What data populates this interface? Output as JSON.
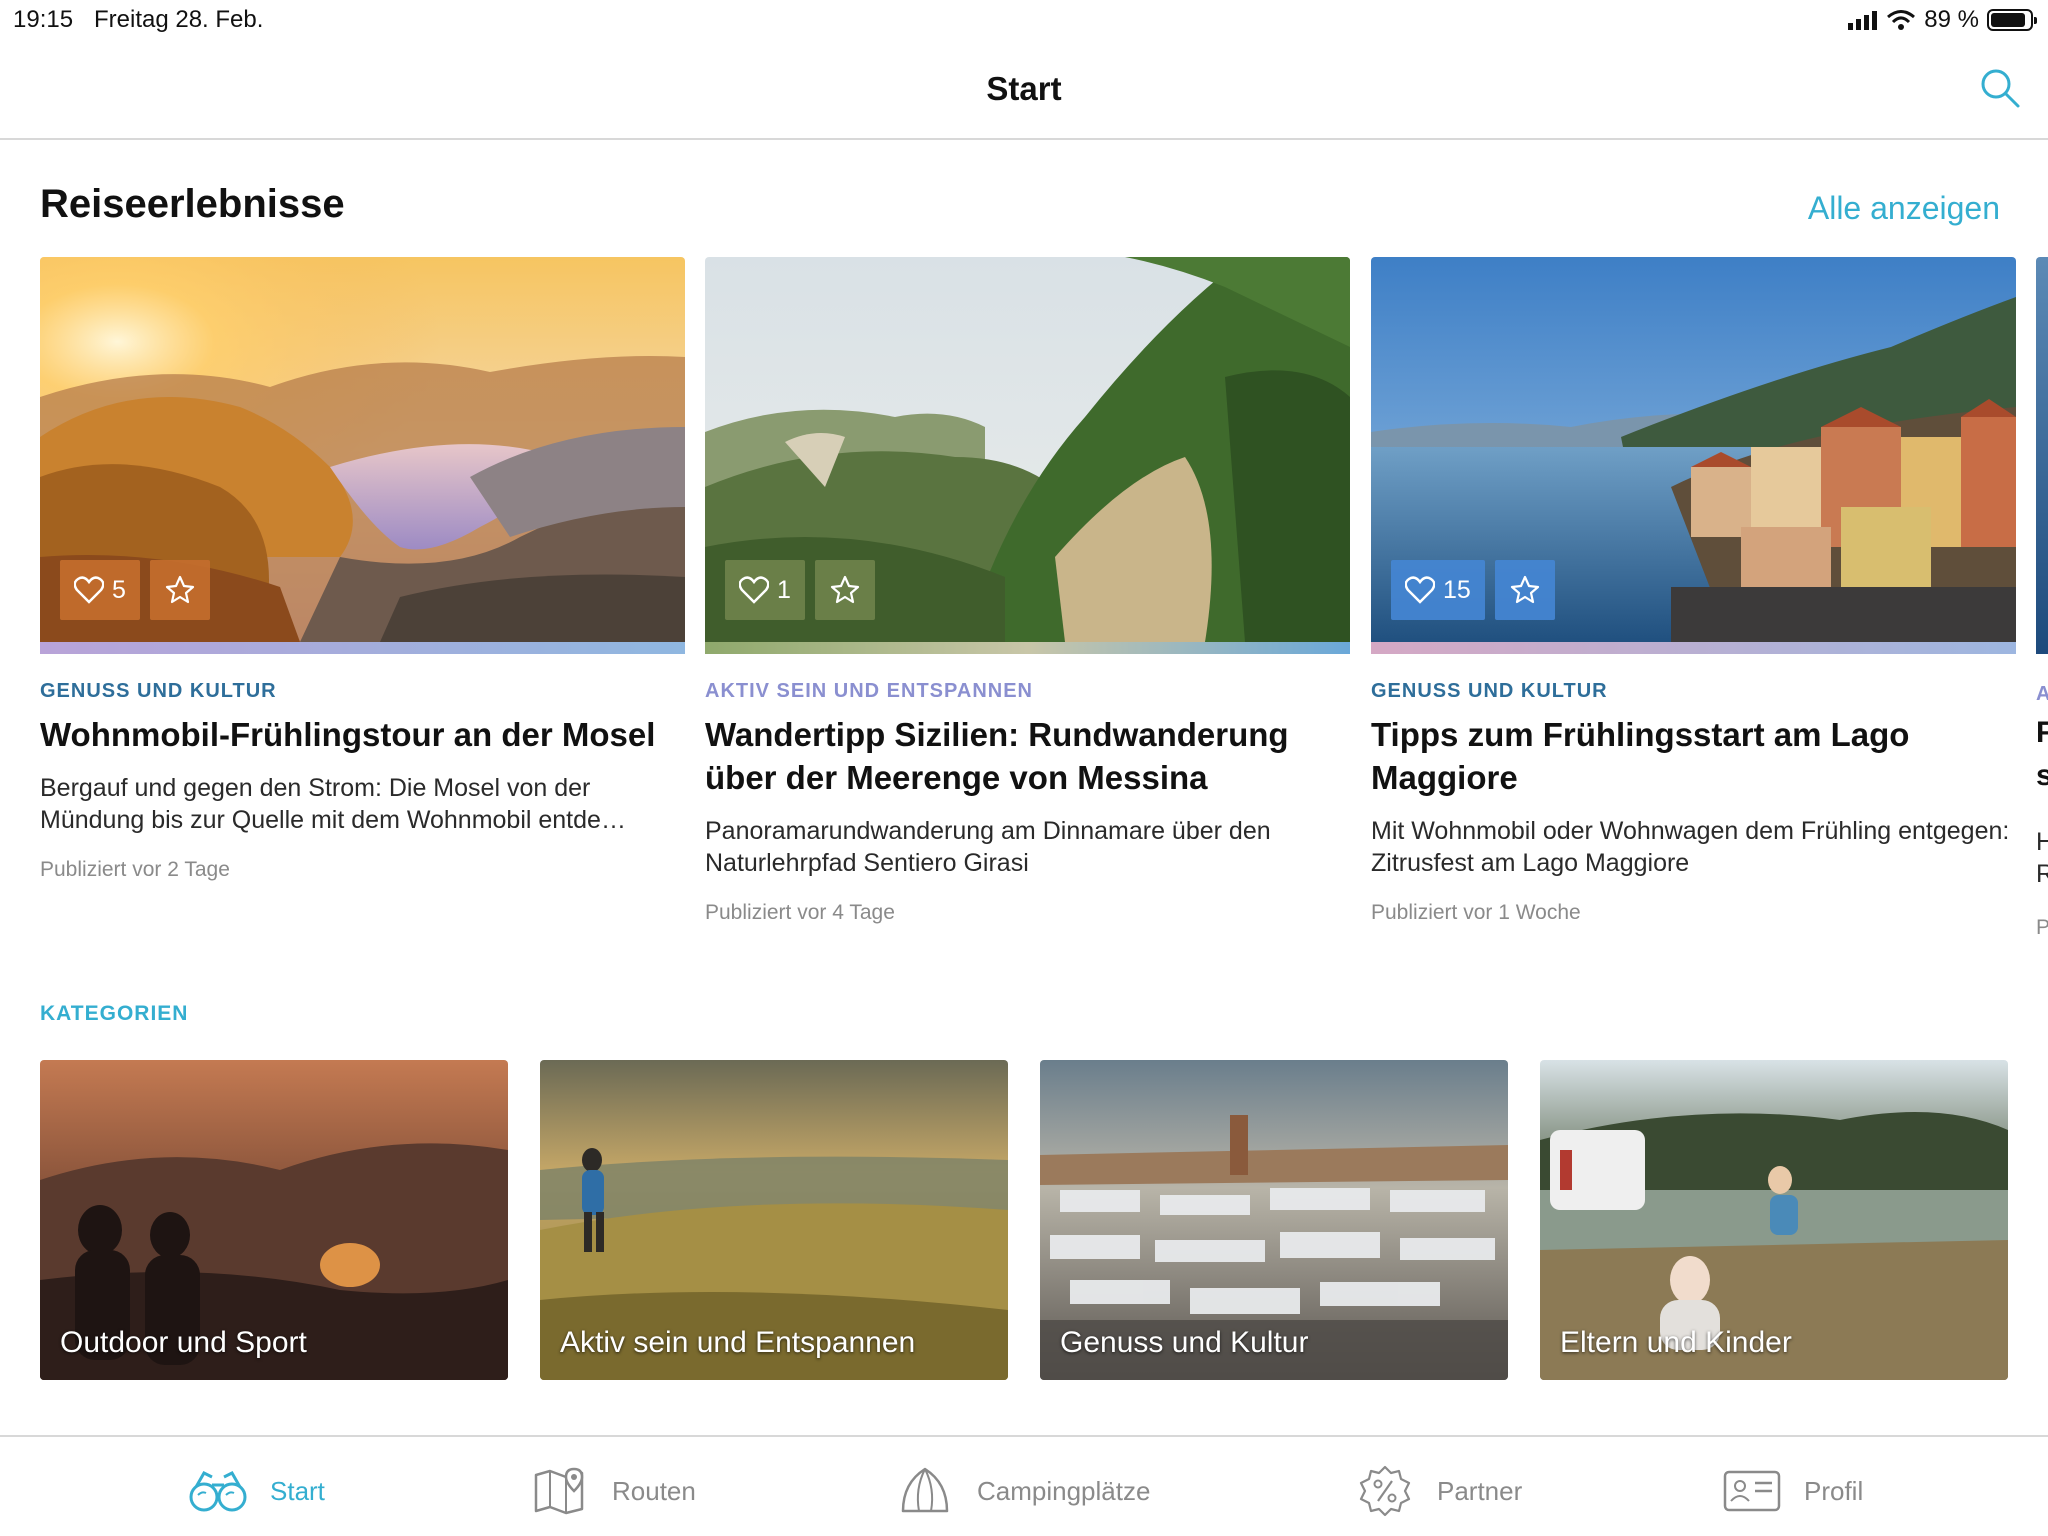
{
  "status_bar": {
    "time": "19:15",
    "date": "Freitag 28. Feb.",
    "battery": "89 %",
    "battery_level": 0.89
  },
  "nav": {
    "title": "Start"
  },
  "section": {
    "title": "Reiseerlebnisse",
    "show_all": "Alle anzeigen"
  },
  "colors": {
    "accent": "#34aed0",
    "category_blue": "#2e6e9a",
    "category_purple": "#8a8fd0"
  },
  "cards": [
    {
      "likes": "5",
      "category": "GENUSS UND KULTUR",
      "title": "Wohnmobil-Frühlingstour an der Mosel",
      "description": "Bergauf und gegen den Strom: Die Mosel von der Mündung bis zur Quelle mit dem Wohnmobil entde…",
      "published": "Publiziert vor 2 Tage"
    },
    {
      "likes": "1",
      "category": "AKTIV SEIN UND ENTSPANNEN",
      "title": "Wandertipp Sizilien: Rundwanderung über der Meerenge von Messina",
      "description": "Panoramarundwanderung am Dinnamare über den Naturlehrpfad Sentiero Girasi",
      "published": "Publiziert vor 4 Tage"
    },
    {
      "likes": "15",
      "category": "GENUSS UND KULTUR",
      "title": "Tipps zum Frühlingsstart am Lago Maggiore",
      "description": "Mit Wohnmobil oder Wohnwagen dem Frühling entgegen: Zitrusfest am Lago Maggiore",
      "published": "Publiziert vor 1 Woche"
    }
  ],
  "peek_card": {
    "category": "A",
    "title_1": "F",
    "title_2": "s",
    "desc_1": "H",
    "desc_2": "R",
    "published": "P"
  },
  "categories": {
    "label": "KATEGORIEN",
    "items": [
      {
        "label": "Outdoor und Sport"
      },
      {
        "label": "Aktiv sein und Entspannen"
      },
      {
        "label": "Genuss und Kultur"
      },
      {
        "label": "Eltern und Kinder"
      }
    ]
  },
  "tabs": [
    {
      "label": "Start",
      "icon": "binoculars-icon",
      "active": true
    },
    {
      "label": "Routen",
      "icon": "map-pin-icon"
    },
    {
      "label": "Campingplätze",
      "icon": "tent-icon"
    },
    {
      "label": "Partner",
      "icon": "percent-badge-icon"
    },
    {
      "label": "Profil",
      "icon": "id-card-icon"
    }
  ]
}
